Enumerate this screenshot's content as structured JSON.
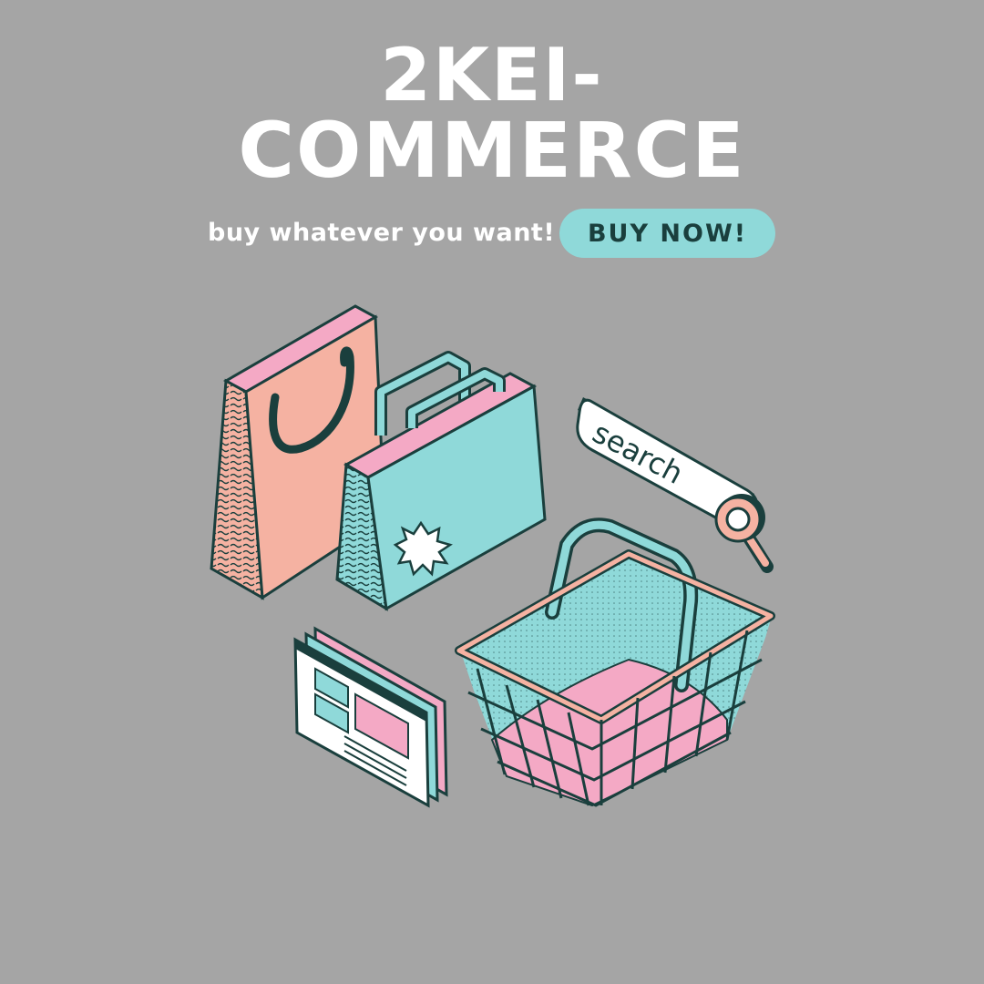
{
  "header": {
    "title_line1": "2KEI-",
    "title_line2": "COMMERCE",
    "tagline": "buy whatever you want!",
    "cta_label": "BUY NOW!"
  },
  "illustration": {
    "search_text": "search"
  },
  "colors": {
    "background": "#a5a5a5",
    "teal": "#8fd9d9",
    "pink": "#f4a9c5",
    "peach": "#f5b2a2",
    "dark": "#1a3f3d",
    "white": "#ffffff"
  }
}
